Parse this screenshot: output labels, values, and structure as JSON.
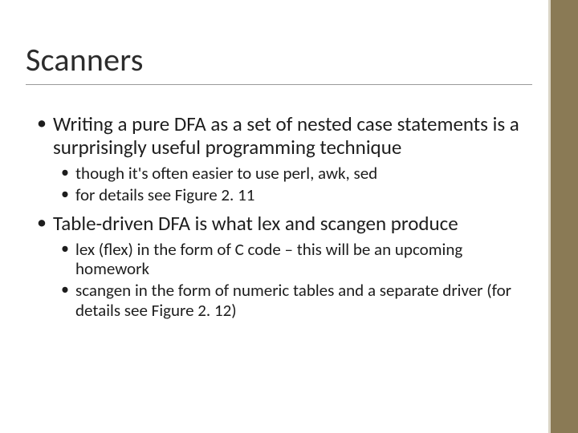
{
  "title": "Scanners",
  "bullets": {
    "b1": "Writing a pure DFA as a set of nested case statements is a surprisingly useful programming technique",
    "b1_sub1": "though it's often easier to use perl, awk, sed",
    "b1_sub2": "for details see Figure 2. 11",
    "b2": "Table-driven DFA is what lex and scangen produce",
    "b2_sub1": "lex (flex) in the form of C code – this will be an upcoming homework",
    "b2_sub2": "scangen in the form of numeric tables and a separate driver (for details see Figure 2. 12)"
  }
}
